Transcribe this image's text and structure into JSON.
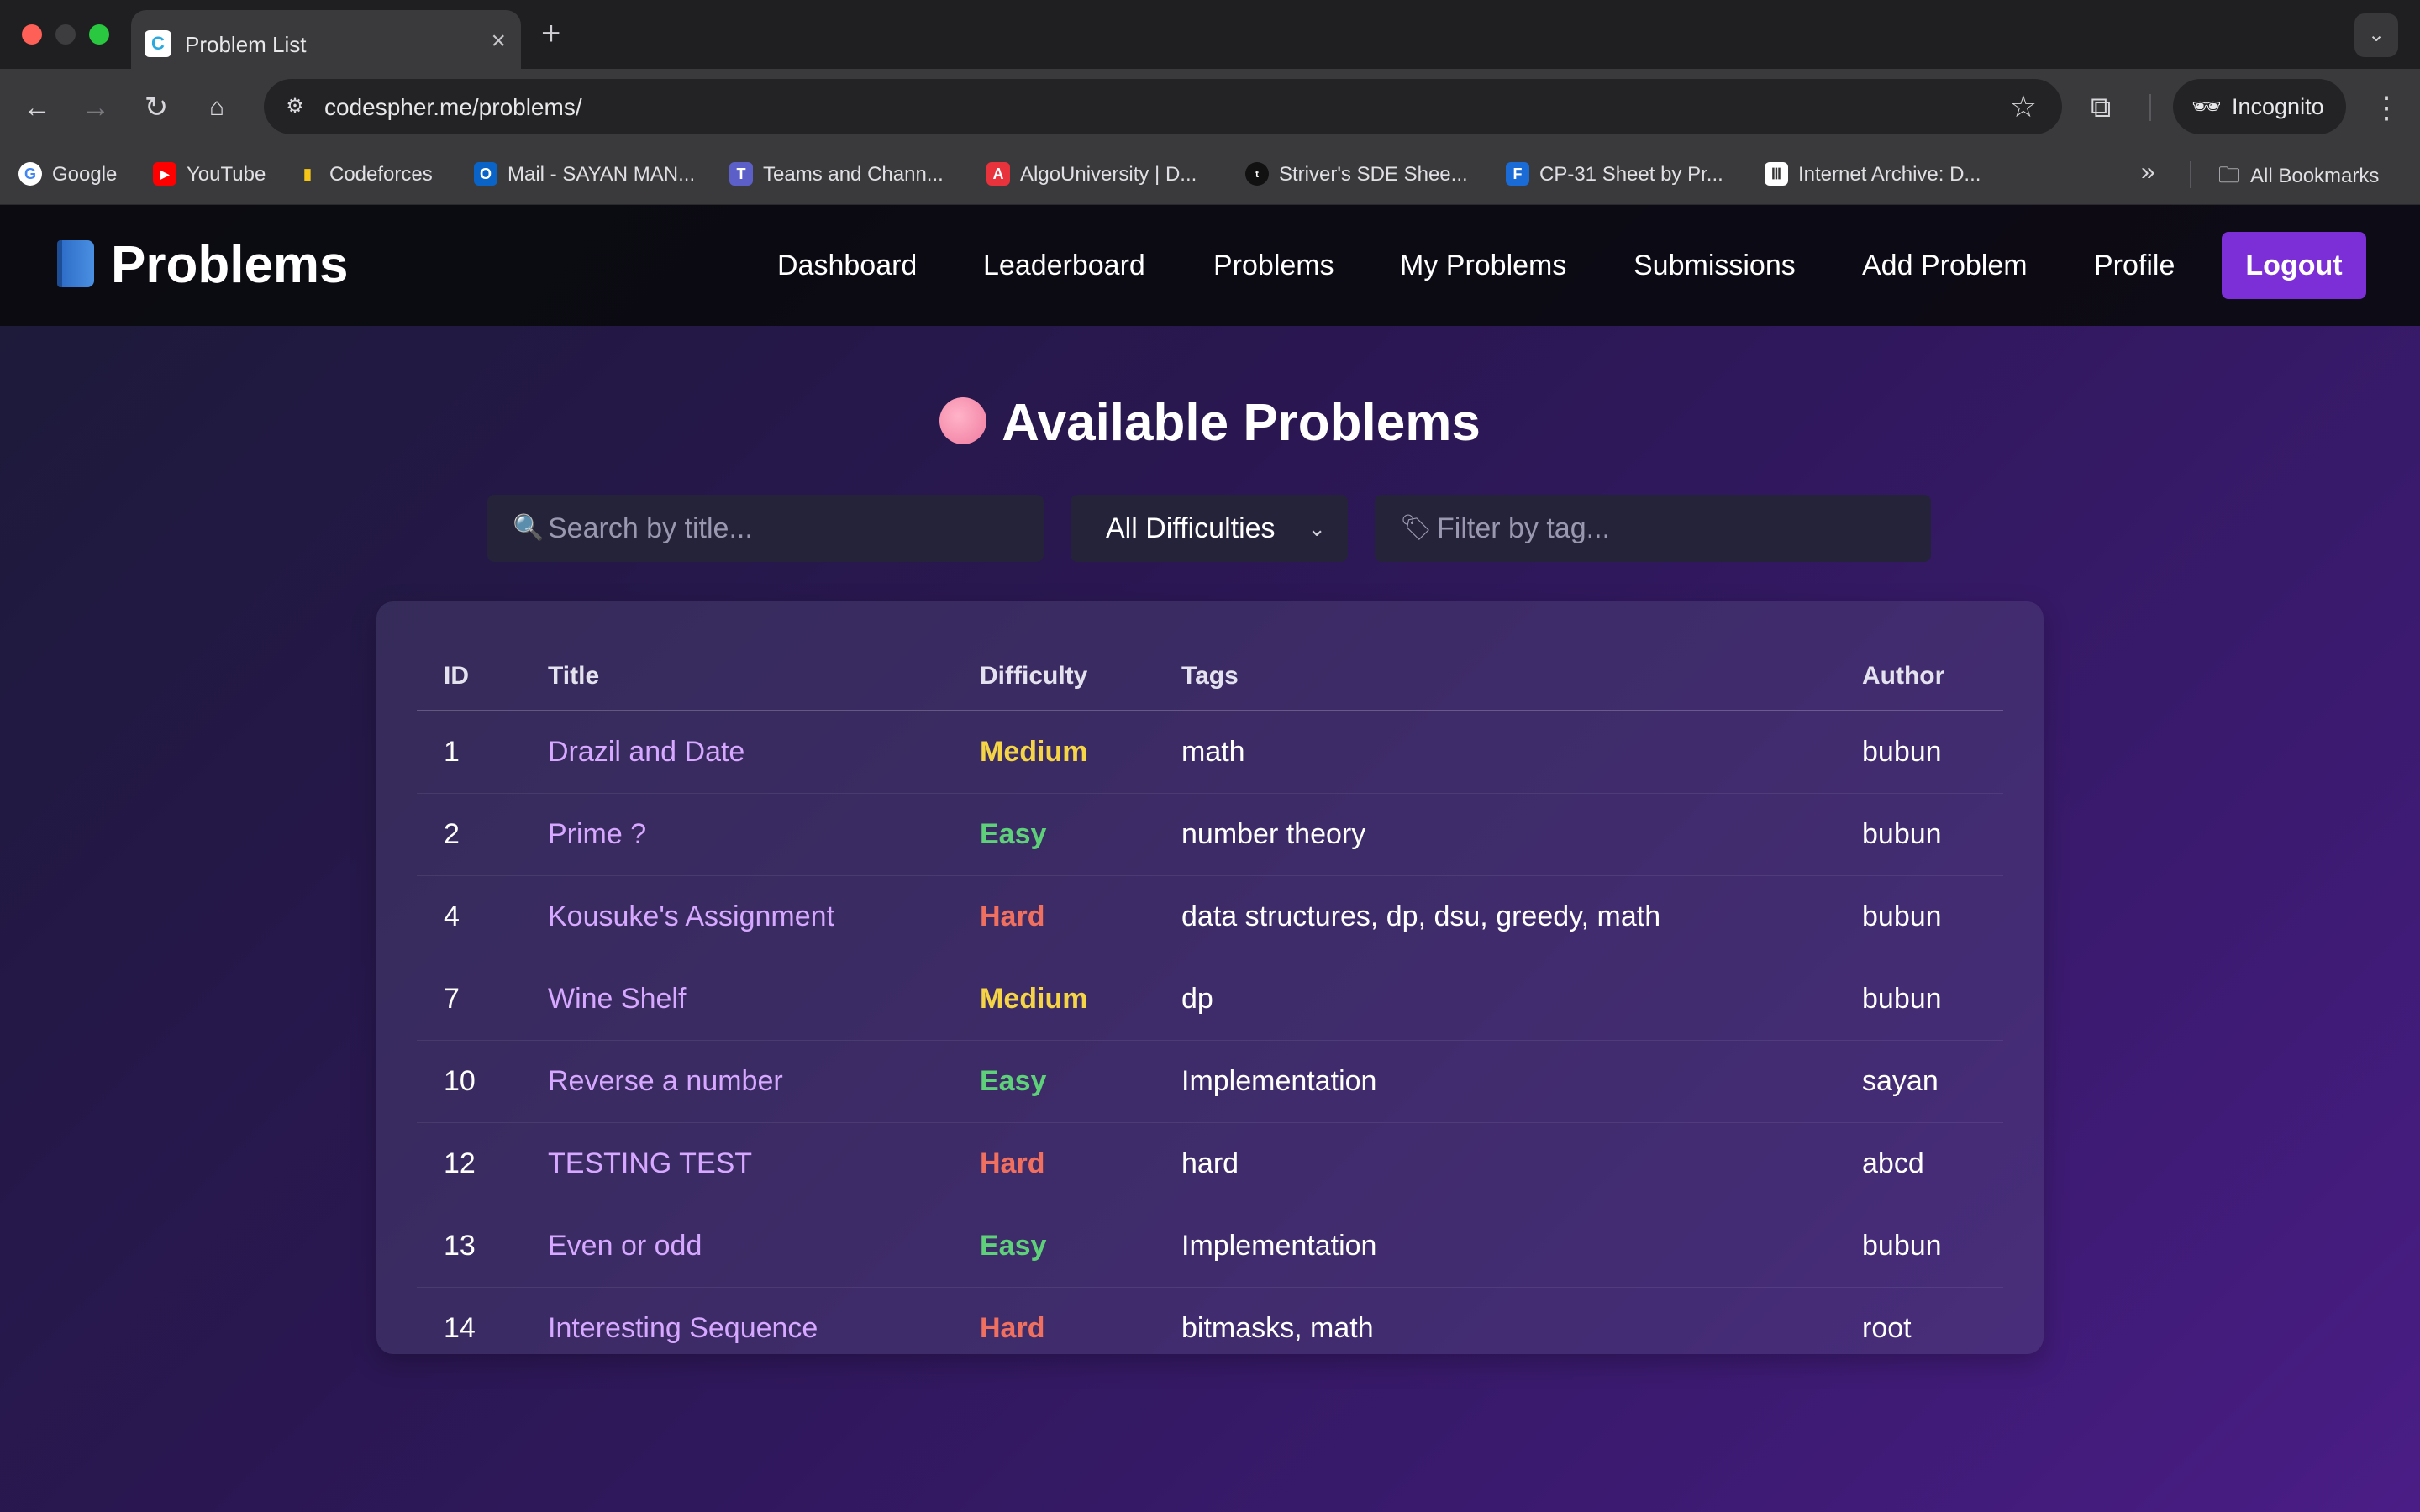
{
  "browser": {
    "tab_title": "Problem List",
    "tab_favicon": "C",
    "url_host": "codespher.me",
    "url_path": "/problems/",
    "incognito_label": "Incognito",
    "bookmarks": [
      {
        "label": "Google",
        "icon": "google-icon",
        "color": "#4285f4",
        "glyph": "G"
      },
      {
        "label": "YouTube",
        "icon": "youtube-icon",
        "color": "#ff0000",
        "glyph": "▶"
      },
      {
        "label": "Codeforces",
        "icon": "codeforces-icon",
        "color": "#1f8acb",
        "glyph": "▮"
      },
      {
        "label": "Mail - SAYAN MAN...",
        "icon": "outlook-icon",
        "color": "#0a64c8",
        "glyph": "O"
      },
      {
        "label": "Teams and Chann...",
        "icon": "teams-icon",
        "color": "#5b5fc7",
        "glyph": "T"
      },
      {
        "label": "AlgoUniversity | D...",
        "icon": "algouniversity-icon",
        "color": "#e8323c",
        "glyph": "A"
      },
      {
        "label": "Striver's SDE Shee...",
        "icon": "tuf-icon",
        "color": "#111111",
        "glyph": "t"
      },
      {
        "label": "CP-31 Sheet by Pr...",
        "icon": "cp31-icon",
        "color": "#1a6bd6",
        "glyph": "F"
      },
      {
        "label": "Internet Archive: D...",
        "icon": "archive-icon",
        "color": "#444444",
        "glyph": "Ⅲ"
      }
    ],
    "all_bookmarks_label": "All Bookmarks"
  },
  "navbar": {
    "brand": "Problems",
    "links": [
      "Dashboard",
      "Leaderboard",
      "Problems",
      "My Problems",
      "Submissions",
      "Add Problem",
      "Profile"
    ],
    "logout_label": "Logout"
  },
  "main": {
    "heading": "Available Problems",
    "search_placeholder": "Search by title...",
    "difficulty_selected": "All Difficulties",
    "tag_placeholder": "Filter by tag..."
  },
  "table": {
    "headers": {
      "id": "ID",
      "title": "Title",
      "difficulty": "Difficulty",
      "tags": "Tags",
      "author": "Author"
    },
    "rows": [
      {
        "id": "1",
        "title": "Drazil and Date",
        "difficulty": "Medium",
        "tags": "math",
        "author": "bubun"
      },
      {
        "id": "2",
        "title": "Prime ?",
        "difficulty": "Easy",
        "tags": "number theory",
        "author": "bubun"
      },
      {
        "id": "4",
        "title": "Kousuke's Assignment",
        "difficulty": "Hard",
        "tags": "data structures, dp, dsu, greedy, math",
        "author": "bubun"
      },
      {
        "id": "7",
        "title": "Wine Shelf",
        "difficulty": "Medium",
        "tags": "dp",
        "author": "bubun"
      },
      {
        "id": "10",
        "title": "Reverse a number",
        "difficulty": "Easy",
        "tags": "Implementation",
        "author": "sayan"
      },
      {
        "id": "12",
        "title": "TESTING TEST",
        "difficulty": "Hard",
        "tags": "hard",
        "author": "abcd"
      },
      {
        "id": "13",
        "title": "Even or odd",
        "difficulty": "Easy",
        "tags": "Implementation",
        "author": "bubun"
      },
      {
        "id": "14",
        "title": "Interesting Sequence",
        "difficulty": "Hard",
        "tags": "bitmasks, math",
        "author": "root"
      }
    ]
  },
  "colors": {
    "accent": "#7c2fd6",
    "title_link": "#d6a8ff",
    "Easy": "#5fd07a",
    "Medium": "#f5d546",
    "Hard": "#f07060"
  }
}
